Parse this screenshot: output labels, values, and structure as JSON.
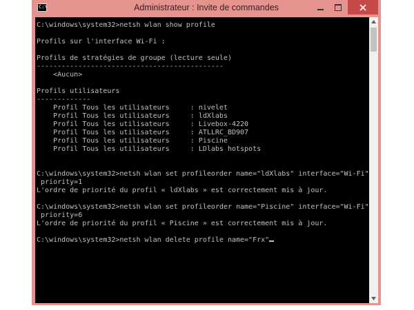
{
  "window": {
    "title": "Administrateur : Invite de commandes",
    "icon": "cmd-icon",
    "icon_text": "C:\\",
    "accent_color": "#e5938f",
    "close_color": "#c74a48"
  },
  "console": {
    "background": "#000000",
    "foreground": "#c0c0c0",
    "lines": [
      "C:\\windows\\system32>netsh wlan show profile",
      "",
      "Profils sur l'interface Wi-Fi :",
      "",
      "Profils de stratégies de groupe (lecture seule)",
      "---------------------------------------------",
      "    <Aucun>",
      "",
      "Profils utilisateurs",
      "-------------",
      "    Profil Tous les utilisateurs     : nivelet",
      "    Profil Tous les utilisateurs     : ldXlabs",
      "    Profil Tous les utilisateurs     : Livebox-4220",
      "    Profil Tous les utilisateurs     : ATLLRC_BD907",
      "    Profil Tous les utilisateurs     : Piscine",
      "    Profil Tous les utilisateurs     : LDlabs hotspots",
      "",
      "",
      "C:\\windows\\system32>netsh wlan set profileorder name=\"ldXlabs\" interface=\"Wi-Fi\"",
      " priority=1",
      "L'ordre de priorité du profil « ldXlabs » est correctement mis à jour.",
      "",
      "C:\\windows\\system32>netsh wlan set profileorder name=\"Piscine\" interface=\"Wi-Fi\"",
      " priority=6",
      "L'ordre de priorité du profil « Piscine » est correctement mis à jour.",
      "",
      "C:\\windows\\system32>netsh wlan delete profile name=\"Frx\""
    ]
  }
}
